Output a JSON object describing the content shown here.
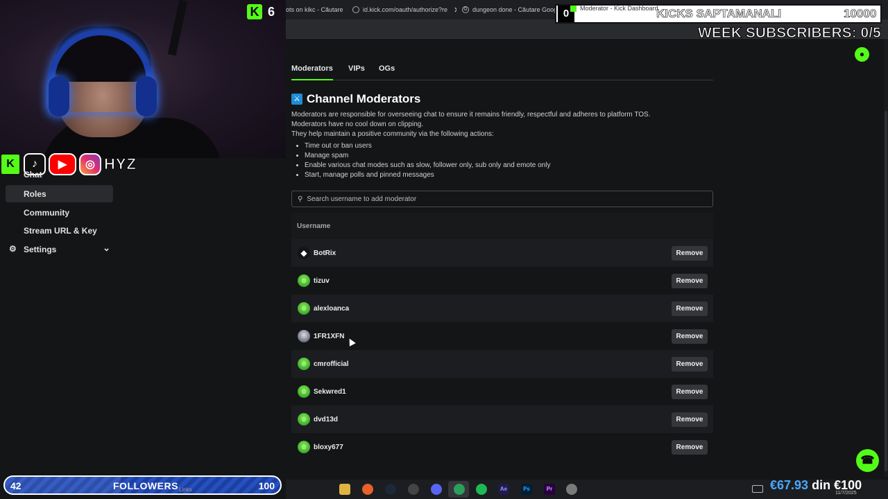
{
  "browser": {
    "tabs": [
      {
        "label": "ots on kikc - Căutare",
        "icon": "google-icon"
      },
      {
        "label": "id.kick.com/oauth/authorize?re",
        "icon": "globe-icon"
      },
      {
        "label": "dungeon done - Căutare Googl",
        "icon": "google-icon"
      },
      {
        "label": "Moderator - Kick Dashboard",
        "icon": "kick-icon"
      }
    ]
  },
  "overlay": {
    "kick_count": "6",
    "social_handle": "HYZ",
    "kicks_left_counter": "0",
    "kicks_title": "KICKS SAPTAMANALI",
    "kicks_goal": "10000",
    "week_subscribers": "WEEK SUBSCRIBERS: 0/5",
    "followers_current": "42",
    "followers_label": "FOLLOWERS",
    "followers_goal": "100",
    "followers_progress_fraction": 0.42,
    "links_label": "Links",
    "money_amount": "€67.93",
    "money_sep": "din",
    "money_goal": "€100",
    "taskbar_date": "11/7/2025"
  },
  "sidebar": {
    "items": [
      {
        "label": "Chat",
        "active": false
      },
      {
        "label": "Roles",
        "active": true
      },
      {
        "label": "Community",
        "active": false
      },
      {
        "label": "Stream URL & Key",
        "active": false
      },
      {
        "label": "Settings",
        "active": false,
        "icon": "gear-icon",
        "expandable": true
      }
    ]
  },
  "main": {
    "tabs": [
      {
        "label": "Moderators",
        "active": true
      },
      {
        "label": "VIPs",
        "active": false
      },
      {
        "label": "OGs",
        "active": false
      }
    ],
    "title": "Channel Moderators",
    "description_lines": [
      "Moderators are responsible for overseeing chat to ensure it remains friendly, respectful and adheres to platform TOS.",
      "Moderators have no cool down on clipping.",
      "They help maintain a positive community via the following actions:"
    ],
    "actions": [
      "Time out or ban users",
      "Manage spam",
      "Enable various chat modes such as slow, follower only, sub only and emote only",
      "Start, manage polls and pinned messages"
    ],
    "search_placeholder": "Search username to add moderator",
    "table_header": "Username",
    "remove_label": "Remove",
    "moderators": [
      {
        "username": "BotRix",
        "avatar": "bot"
      },
      {
        "username": "tizuv",
        "avatar": "default"
      },
      {
        "username": "alexloanca",
        "avatar": "default"
      },
      {
        "username": "1FR1XFN",
        "avatar": "photo"
      },
      {
        "username": "cmrofficial",
        "avatar": "default"
      },
      {
        "username": "Sekwred1",
        "avatar": "default"
      },
      {
        "username": "dvd13d",
        "avatar": "default"
      },
      {
        "username": "bloxy677",
        "avatar": "default"
      }
    ]
  },
  "colors": {
    "accent": "#53fc18",
    "background": "#141517",
    "row_alt": "#1c1d20",
    "button": "#35363a"
  }
}
